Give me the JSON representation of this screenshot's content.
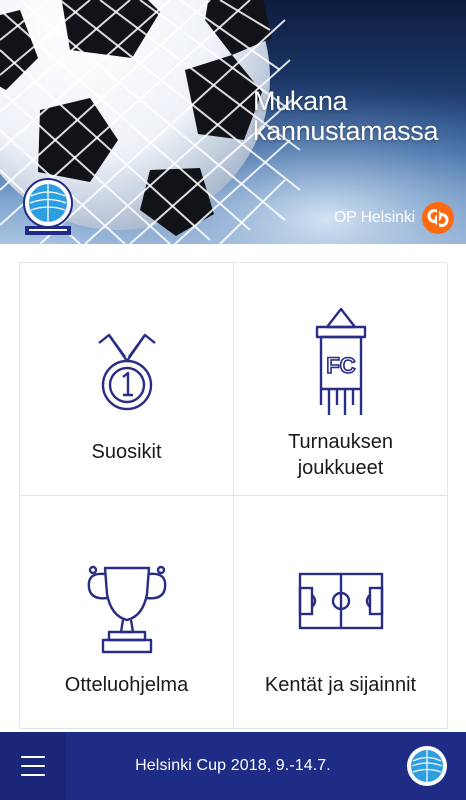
{
  "banner": {
    "slogan": "Mukana\nkannustamassa",
    "sponsor_name": "OP Helsinki",
    "brand_colors": {
      "sponsor_orange": "#ff6a10",
      "sky_blue": "#3d6aa4"
    },
    "badge_icon": "helsinki-cup-logo",
    "sponsor_icon": "op-logo"
  },
  "tiles": [
    {
      "label": "Suosikit",
      "icon": "medal-icon"
    },
    {
      "label": "Turnauksen\njoukkueet",
      "icon": "fc-pennant-icon"
    },
    {
      "label": "Otteluohjelma",
      "icon": "trophy-icon"
    },
    {
      "label": "Kentät ja sijainnit",
      "icon": "football-field-icon"
    }
  ],
  "bottom_bar": {
    "title": "Helsinki Cup 2018, 9.-14.7.",
    "menu_icon": "hamburger-menu-icon",
    "logo_icon": "helsinki-cup-logo",
    "background": "#1f2c86"
  },
  "icon_color": "#2a2d86"
}
